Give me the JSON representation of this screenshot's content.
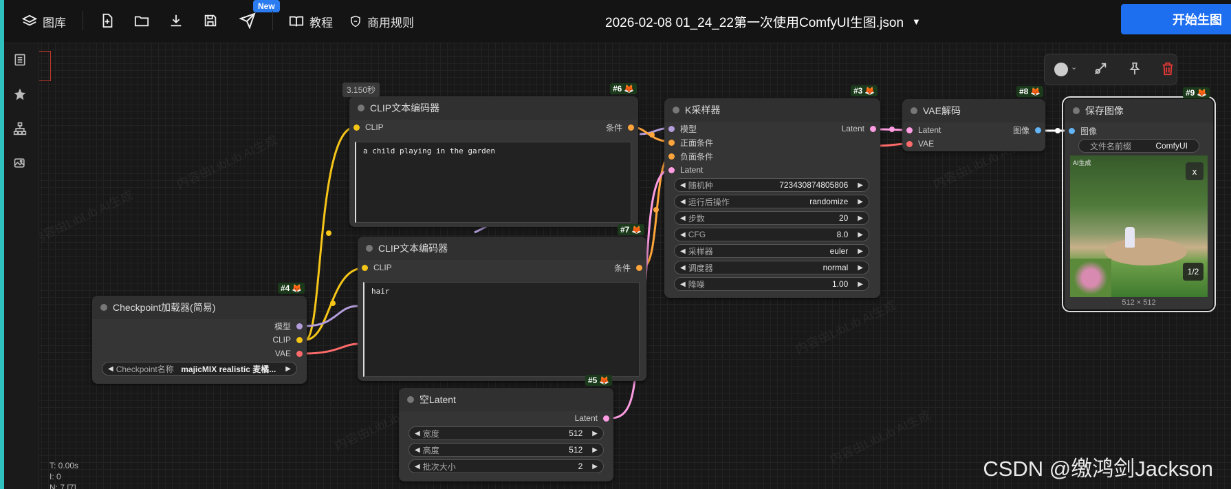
{
  "topbar": {
    "gallery_label": "图库",
    "new_badge": "New",
    "tutorial_label": "教程",
    "rules_label": "商用规则",
    "doc_title": "2026-02-08 01_24_22第一次使用ComfyUI生图.json",
    "start_label": "开始生图"
  },
  "exec_time": "3.150秒",
  "nodes": {
    "clip1": {
      "badge": "#6",
      "title": "CLIP文本编码器",
      "in_clip": "CLIP",
      "out_cond": "条件",
      "text": "a child playing in the garden"
    },
    "clip2": {
      "badge": "#7",
      "title": "CLIP文本编码器",
      "in_clip": "CLIP",
      "out_cond": "条件",
      "text": "hair"
    },
    "ksampler": {
      "badge": "#3",
      "title": "K采样器",
      "in_model": "模型",
      "in_pos": "正面条件",
      "in_neg": "负面条件",
      "in_latent": "Latent",
      "out_latent": "Latent",
      "widgets": [
        {
          "label": "随机种",
          "value": "723430874805806"
        },
        {
          "label": "运行后操作",
          "value": "randomize"
        },
        {
          "label": "步数",
          "value": "20"
        },
        {
          "label": "CFG",
          "value": "8.0"
        },
        {
          "label": "采样器",
          "value": "euler"
        },
        {
          "label": "调度器",
          "value": "normal"
        },
        {
          "label": "降噪",
          "value": "1.00"
        }
      ]
    },
    "vae": {
      "badge": "#8",
      "title": "VAE解码",
      "in_latent": "Latent",
      "in_vae": "VAE",
      "out_image": "图像"
    },
    "save": {
      "badge": "#9",
      "title": "保存图像",
      "in_image": "图像",
      "prefix_label": "文件名前缀",
      "prefix_value": "ComfyUI",
      "img_tag": "AI生成",
      "close": "x",
      "page": "1/2",
      "size": "512 × 512"
    },
    "checkpoint": {
      "badge": "#4",
      "title": "Checkpoint加载器(简易)",
      "out_model": "模型",
      "out_clip": "CLIP",
      "out_vae": "VAE",
      "widget_label": "Checkpoint名称",
      "widget_value": "majicMIX realistic 麦橘..."
    },
    "latent": {
      "badge": "#5",
      "title": "空Latent",
      "out_latent": "Latent",
      "widgets": [
        {
          "label": "宽度",
          "value": "512"
        },
        {
          "label": "高度",
          "value": "512"
        },
        {
          "label": "批次大小",
          "value": "2"
        }
      ]
    }
  },
  "stats": {
    "t": "T: 0.00s",
    "i": "I: 0",
    "n": "N: 7 [7]"
  },
  "watermark": "CSDN @缴鸿剑Jackson",
  "faint_watermark": "内容由LibLib AI生成",
  "colors": {
    "clip": "#f5c518",
    "model": "#b39ddb",
    "vae": "#ff6b6b",
    "latent": "#ff9de2",
    "cond": "#ffa53b",
    "image": "#64b5f6",
    "accent": "#1e6ff0"
  }
}
